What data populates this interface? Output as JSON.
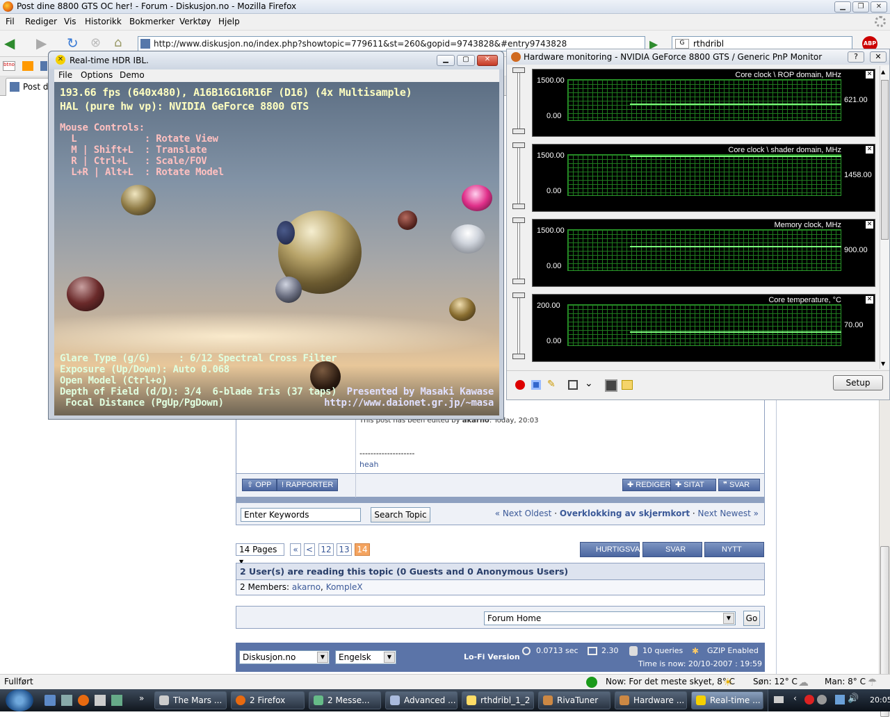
{
  "firefox": {
    "title": "Post dine 8800 GTS OC her! - Forum - Diskusjon.no - Mozilla Firefox",
    "menu": [
      "Fil",
      "Rediger",
      "Vis",
      "Historikk",
      "Bokmerker",
      "Verktøy",
      "Hjelp"
    ],
    "url": "http://www.diskusjon.no/index.php?showtopic=779611&st=260&gopid=9743828&#entry9743828",
    "search": "rthdribl",
    "tab_label": "Post di",
    "status": "Fullført",
    "weather": {
      "now": "Now: For det meste skyet, 8° C",
      "sun": "Søn: 12° C",
      "mon": "Man: 8° C"
    }
  },
  "forum": {
    "edited_prefix": "This post has been edited by ",
    "edited_user": "akarno",
    "edited_time": ": Today, 20:03",
    "signature_line": "--------------------",
    "signature": "heah",
    "buttons": {
      "opp": "⇧ OPP",
      "rapporter": "! RAPPORTER",
      "rediger": "✚ REDIGER",
      "sitat": "✚ SITAT",
      "svar": "❞ SVAR"
    },
    "search": {
      "placeholder": "Enter Keywords",
      "button": "Search Topic"
    },
    "topic_nav": {
      "prev": "« Next Oldest",
      "sep1": " · ",
      "title": "Overklokking av skjermkort",
      "sep2": " · ",
      "next": "Next Newest »"
    },
    "pages": {
      "label": "14 Pages",
      "first": "«",
      "prev": "<",
      "p12": "12",
      "p13": "13",
      "p14": "14"
    },
    "action_buttons": {
      "hurtig": "HURTIGSVAR",
      "svar_na": "SVAR NÅ",
      "nytt": "NYTT EMNE"
    },
    "readers": {
      "heading": "2 User(s) are reading this topic (0 Guests and 0 Anonymous Users)",
      "members_label": "2 Members: ",
      "member1": "akarno",
      "sep": ", ",
      "member2": "KompleX"
    },
    "forum_home": {
      "value": "Forum Home",
      "go": "Go"
    },
    "footer": {
      "site": "Diskusjon.no",
      "lang": "Engelsk",
      "lofi": "Lo-Fi Version",
      "time": "0.0713 sec",
      "load": "2.30",
      "queries": "10 queries",
      "gzip": "GZIP Enabled",
      "now": "Time is now: 20/10-2007 : 19:59"
    }
  },
  "hdr": {
    "title": "Real-time HDR IBL.",
    "menu": [
      "File",
      "Options",
      "Demo"
    ],
    "osd": {
      "fps": "193.66 fps (640x480), A16B16G16R16F (D16) (4x Multisample)",
      "hal": "HAL (pure hw vp): NVIDIA GeForce 8800 GTS",
      "mouse": "Mouse Controls:",
      "c1": "  L            : Rotate View",
      "c2": "  M | Shift+L  : Translate",
      "c3": "  R | Ctrl+L   : Scale/FOV",
      "c4": "  L+R | Alt+L  : Rotate Model",
      "glare": "Glare Type (g/G)     : 6/12 Spectral Cross Filter",
      "exposure": "Exposure (Up/Down): Auto 0.068",
      "open": "Open Model (Ctrl+o)",
      "dof": "Depth of Field (d/D): 3/4  6-blade Iris (37 taps)",
      "focal": " Focal Distance (PgUp/PgDown)",
      "credit": "Presented by Masaki Kawase",
      "url": "http://www.daionet.gr.jp/~masa"
    }
  },
  "hwmon": {
    "title": "Hardware monitoring - NVIDIA GeForce 8800 GTS / Generic PnP Monitor",
    "graphs": [
      {
        "name": "Core clock \\ ROP domain, MHz",
        "max": "1500.00",
        "min": "0.00",
        "value": "621.00",
        "fraction": 0.41
      },
      {
        "name": "Core clock \\ shader domain, MHz",
        "max": "1500.00",
        "min": "0.00",
        "value": "1458.00",
        "fraction": 0.97
      },
      {
        "name": "Memory clock, MHz",
        "max": "1500.00",
        "min": "0.00",
        "value": "900.00",
        "fraction": 0.6
      },
      {
        "name": "Core temperature, °C",
        "max": "200.00",
        "min": "0.00",
        "value": "70.00",
        "fraction": 0.35
      }
    ],
    "setup": "Setup"
  },
  "taskbar": {
    "items": [
      "The Mars ...",
      "2 Firefox",
      "2 Messe...",
      "Advanced ...",
      "rthdribl_1_2",
      "RivaTuner",
      "Hardware ...",
      "Real-time ..."
    ],
    "clock": "20:05"
  }
}
